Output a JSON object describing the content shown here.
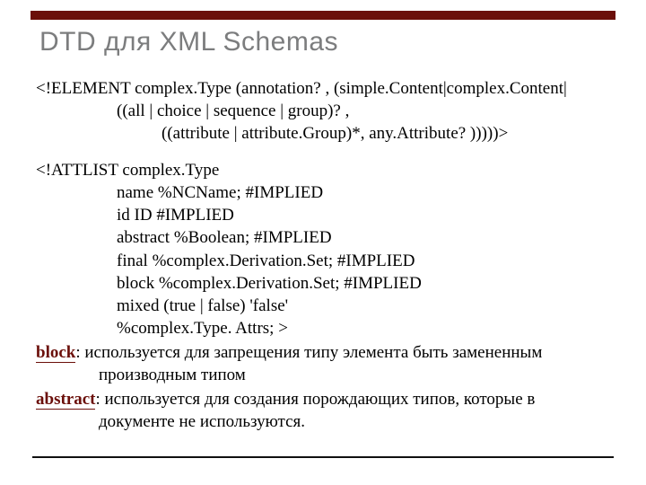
{
  "title": "DTD для XML Schemas",
  "element": {
    "line1": "<!ELEMENT complex.Type (annotation? , (simple.Content|complex.Content|",
    "line2": "((all | choice | sequence | group)? ,",
    "line3": "((attribute | attribute.Group)*, any.Attribute? )))))>"
  },
  "attlist": {
    "open": "<!ATTLIST complex.Type",
    "rows": [
      "name  %NCName; #IMPLIED",
      "id  ID   #IMPLIED",
      "abstract   %Boolean; #IMPLIED",
      "final     %complex.Derivation.Set; #IMPLIED",
      "block    %complex.Derivation.Set; #IMPLIED",
      "mixed (true | false) 'false'",
      "%complex.Type. Attrs; >"
    ]
  },
  "descriptions": {
    "block_label": "block",
    "block_text_1": ": используется для запрещения типу элемента быть замененным",
    "block_text_2": "производным типом",
    "abstract_label": "abstract",
    "abstract_text_1": ": используется для создания порождающих типов, которые в",
    "abstract_text_2": "документе не используются."
  }
}
